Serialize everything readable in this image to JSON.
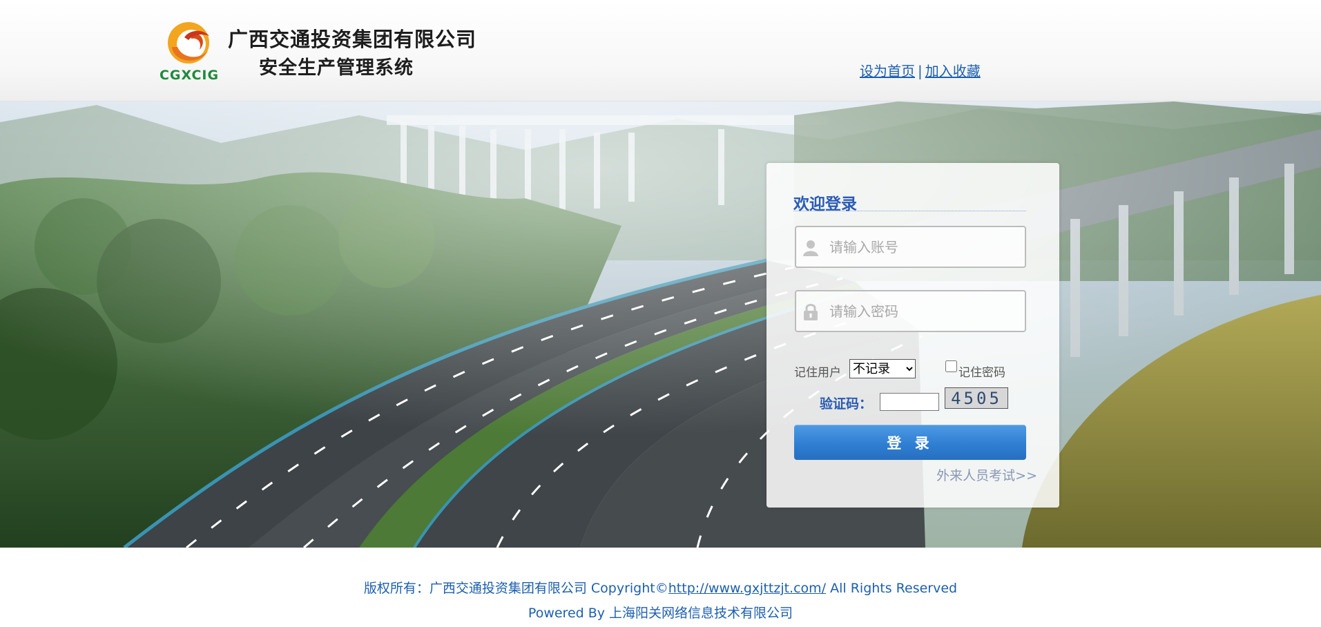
{
  "header": {
    "logo_text": "CGXCIG",
    "company_name": "广西交通投资集团有限公司",
    "system_name": "安全生产管理系统",
    "links": {
      "set_home": "设为首页",
      "separator": "|",
      "add_favorite": "加入收藏"
    }
  },
  "login": {
    "title": "欢迎登录",
    "username_placeholder": "请输入账号",
    "password_placeholder": "请输入密码",
    "remember_user_label": "记住用户",
    "remember_user_selected": "不记录",
    "remember_password_label": "记住密码",
    "captcha_label": "验证码：",
    "captcha_code": "4505",
    "login_button": "登 录",
    "external_exam_link": "外来人员考试>>"
  },
  "footer": {
    "copyright_prefix": "版权所有：广西交通投资集团有限公司 Copyright©",
    "copyright_url": "http://www.gxjttzjt.com/",
    "copyright_suffix": " All Rights Reserved",
    "powered_by": "Powered By 上海阳关网络信息技术有限公司"
  },
  "colors": {
    "brand_blue": "#2a5bb4",
    "link_blue": "#1c5fae",
    "button_blue": "#2f7fd3",
    "logo_green": "#1f8a3c",
    "logo_orange": "#e8741e"
  },
  "icons": {
    "username": "user-icon",
    "password": "lock-icon",
    "logo": "cgxcig-emblem-icon"
  }
}
